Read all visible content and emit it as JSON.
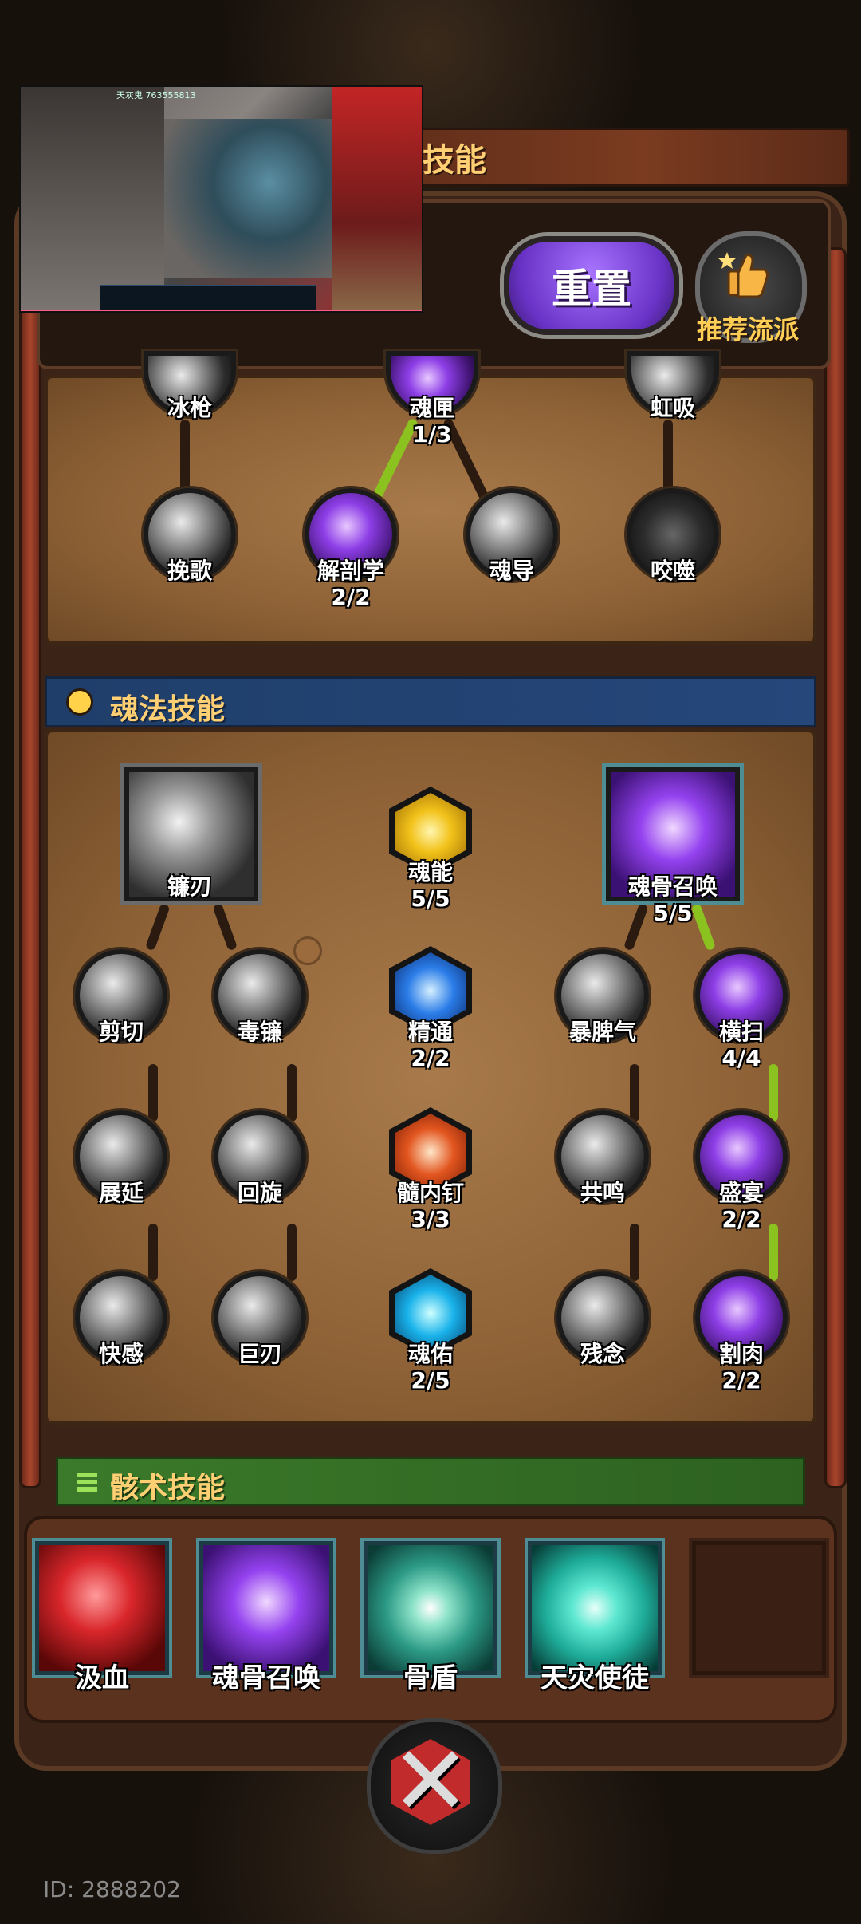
{
  "header": {
    "title_fragment": "技能",
    "reset_label": "重置",
    "recommend_label": "推荐流派"
  },
  "video_overlay": {
    "label": "天灰鬼 763555813"
  },
  "top_tree": {
    "row1": [
      {
        "name": "冰枪"
      },
      {
        "name": "魂匣",
        "level": "1/3"
      },
      {
        "name": "虹吸"
      }
    ],
    "row2": [
      {
        "name": "挽歌"
      },
      {
        "name": "解剖学",
        "level": "2/2"
      },
      {
        "name": "魂导"
      },
      {
        "name": "咬噬"
      }
    ]
  },
  "soul_section": {
    "title": "魂法技能",
    "left_root": {
      "name": "镰刃"
    },
    "right_root": {
      "name": "魂骨召唤",
      "level": "5/5"
    },
    "center": [
      {
        "name": "魂能",
        "level": "5/5"
      },
      {
        "name": "精通",
        "level": "2/2"
      },
      {
        "name": "髓内钉",
        "level": "3/3"
      },
      {
        "name": "魂佑",
        "level": "2/5"
      }
    ],
    "left_col1": [
      {
        "name": "剪切"
      },
      {
        "name": "展延"
      },
      {
        "name": "快感"
      }
    ],
    "left_col2": [
      {
        "name": "毒镰"
      },
      {
        "name": "回旋"
      },
      {
        "name": "巨刃"
      }
    ],
    "right_col1": [
      {
        "name": "暴脾气"
      },
      {
        "name": "共鸣"
      },
      {
        "name": "残念"
      }
    ],
    "right_col2": [
      {
        "name": "横扫",
        "level": "4/4"
      },
      {
        "name": "盛宴",
        "level": "2/2"
      },
      {
        "name": "割肉",
        "level": "2/2"
      }
    ]
  },
  "bone_section": {
    "title": "骸术技能",
    "slots": [
      {
        "name": "汲血",
        "icon": "blood-drop-icon",
        "color": "#d9262b"
      },
      {
        "name": "魂骨召唤",
        "icon": "bone-summon-icon",
        "color": "#7a33d6"
      },
      {
        "name": "骨盾",
        "icon": "bone-shield-icon",
        "color": "#2c9a86"
      },
      {
        "name": "天灾使徒",
        "icon": "vortex-icon",
        "color": "#1fae9b"
      }
    ]
  },
  "footer": {
    "id_text": "ID: 2888202"
  },
  "colors": {
    "active_link": "#8cc21f",
    "inactive_link": "#2a1a10",
    "accent_gold": "#ffcf74",
    "reset_purple": "#6a33c7"
  }
}
